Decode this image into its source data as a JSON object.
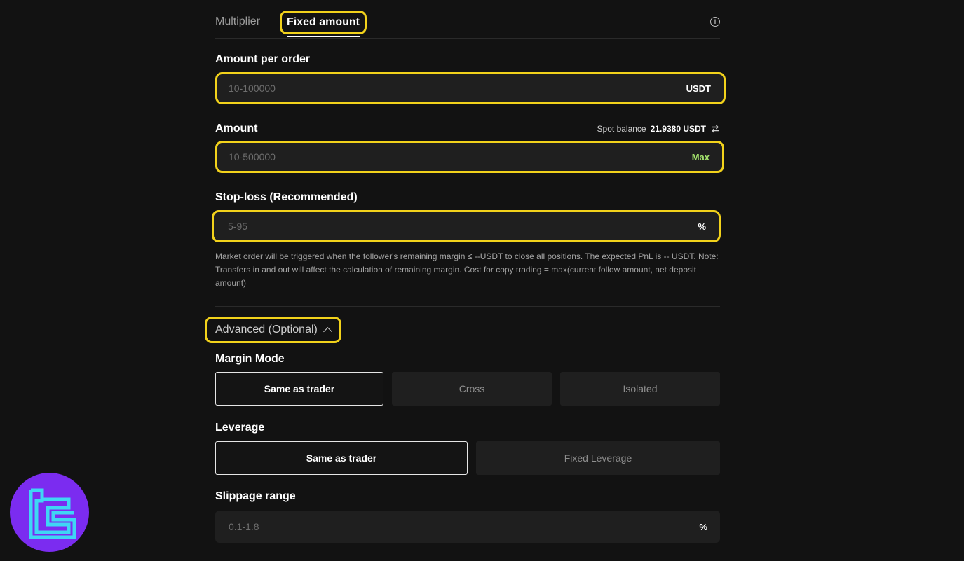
{
  "tabs": {
    "multiplier": "Multiplier",
    "fixed_amount": "Fixed amount"
  },
  "info_icon": "i",
  "amount_per_order": {
    "label": "Amount per order",
    "placeholder": "10-100000",
    "unit": "USDT"
  },
  "amount": {
    "label": "Amount",
    "placeholder": "10-500000",
    "max_label": "Max",
    "balance_label": "Spot balance",
    "balance_value": "21.9380 USDT"
  },
  "stop_loss": {
    "label": "Stop-loss (Recommended)",
    "placeholder": "5-95",
    "unit": "%",
    "note": "Market order will be triggered when the follower's remaining margin ≤ --USDT to close all positions. The expected PnL is -- USDT. Note: Transfers in and out will affect the calculation of remaining margin. Cost for copy trading = max(current follow amount, net deposit amount)"
  },
  "advanced": {
    "label": "Advanced (Optional)"
  },
  "margin_mode": {
    "label": "Margin Mode",
    "options": [
      "Same as trader",
      "Cross",
      "Isolated"
    ],
    "selected": "Same as trader"
  },
  "leverage": {
    "label": "Leverage",
    "options": [
      "Same as trader",
      "Fixed Leverage"
    ],
    "selected": "Same as trader"
  },
  "slippage": {
    "label": "Slippage range",
    "placeholder": "0.1-1.8",
    "unit": "%"
  },
  "colors": {
    "background": "#121212",
    "highlight": "#f2d21b",
    "max_green": "#a4e36c",
    "logo_purple": "#7b2cf0",
    "logo_cyan": "#3fd6f5"
  }
}
